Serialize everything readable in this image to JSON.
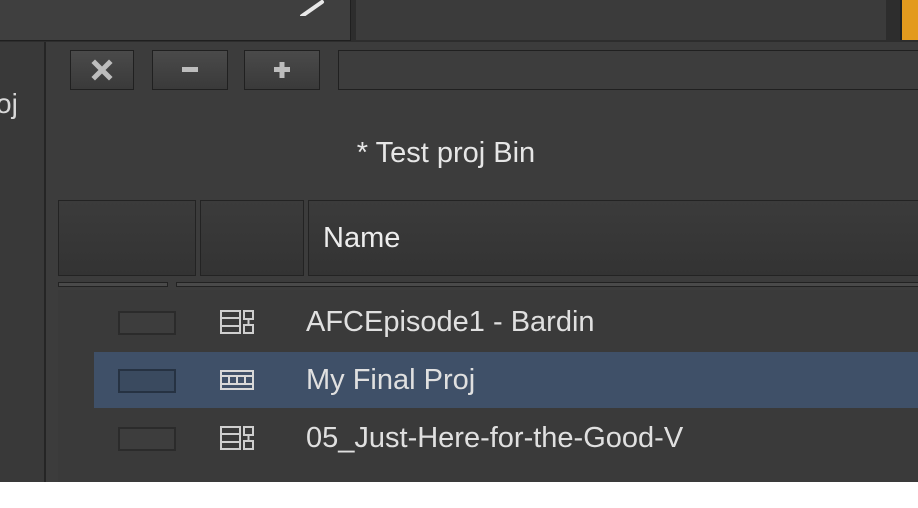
{
  "left_panel": {
    "label": "oj"
  },
  "toolbar": {
    "close_icon": "close-icon",
    "minus_icon": "minus-icon",
    "plus_icon": "plus-icon"
  },
  "bin": {
    "title": "* Test proj Bin",
    "columns": [
      "",
      "",
      "Name"
    ],
    "items": [
      {
        "name": "AFCEpisode1 - Bardin",
        "icon": "sequence-icon",
        "selected": false
      },
      {
        "name": "My Final Proj",
        "icon": "filmstrip-icon",
        "selected": true
      },
      {
        "name": "05_Just-Here-for-the-Good-V",
        "icon": "sequence-icon",
        "selected": false
      }
    ]
  },
  "colors": {
    "background": "#3a3a3a",
    "selected_row": "#3f5068",
    "accent": "#e39a1e",
    "text": "#e0e0e0"
  }
}
